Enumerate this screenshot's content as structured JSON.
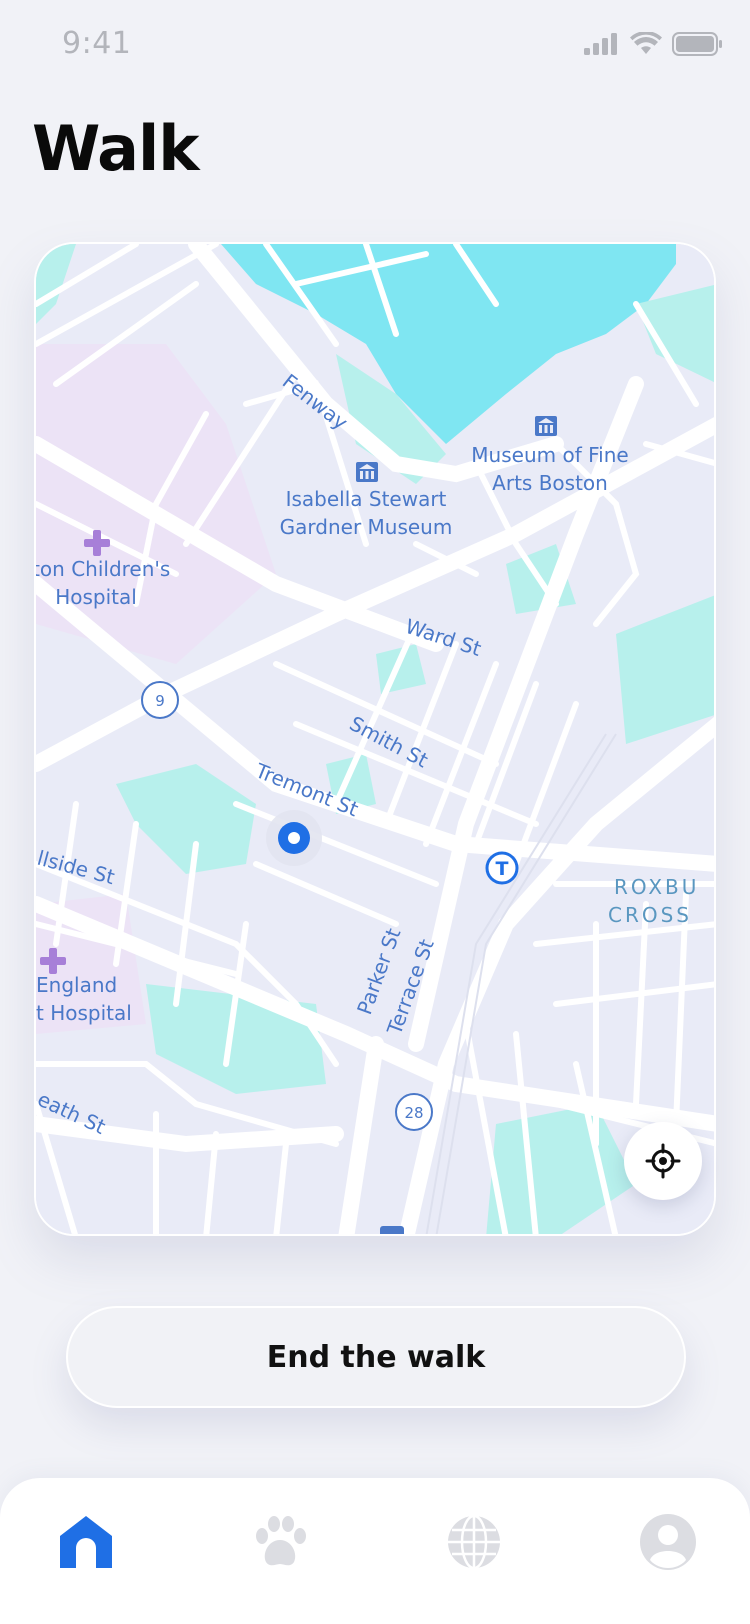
{
  "status": {
    "time": "9:41"
  },
  "page": {
    "title": "Walk"
  },
  "map": {
    "labels": {
      "fenway": "Fenway",
      "museum_fine_arts_1": "Museum of Fine",
      "museum_fine_arts_2": "Arts Boston",
      "gardner_1": "Isabella Stewart",
      "gardner_2": "Gardner Museum",
      "childrens_1": "ston Children's",
      "childrens_2": "Hospital",
      "ward": "Ward St",
      "smith": "Smith St",
      "tremont": "Tremont St",
      "hillside": "llside St",
      "parker": "Parker St",
      "terrace": "Terrace St",
      "roxbury_1": "ROXBU",
      "roxbury_2": "CROSS",
      "england_1": "England",
      "england_2": "t Hospital",
      "heath": "eath St",
      "route_9": "9",
      "route_28": "28",
      "transit": "T"
    }
  },
  "actions": {
    "end_walk": "End the walk"
  },
  "tabs": [
    {
      "name": "home",
      "icon": "home-icon",
      "active": true
    },
    {
      "name": "pets",
      "icon": "paw-icon",
      "active": false
    },
    {
      "name": "explore",
      "icon": "globe-icon",
      "active": false
    },
    {
      "name": "profile",
      "icon": "profile-icon",
      "active": false
    }
  ],
  "colors": {
    "accent": "#1f6fe5",
    "inactive": "#dcdde2",
    "water": "#7fe6f2",
    "park": "#b7f0ec"
  }
}
